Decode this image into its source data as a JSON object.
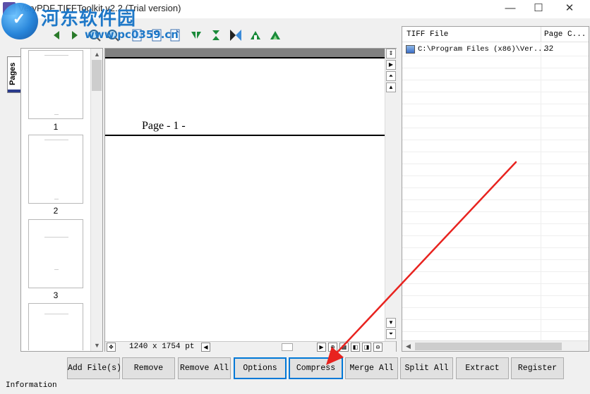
{
  "window": {
    "title": "VeryPDF TIFFToolkit v2.2 (Trial version)",
    "minimize_glyph": "—",
    "maximize_glyph": "☐",
    "close_glyph": "✕"
  },
  "watermark": {
    "site_name": "河东软件园",
    "site_url": "www.pc0359.cn",
    "logo_glyph": "✓"
  },
  "toolbar": {
    "icons": [
      "back-icon",
      "forward-icon",
      "zoom-in-icon",
      "zoom-out-icon",
      "fit-page-icon",
      "fit-width-icon",
      "actual-size-icon",
      "flip-horizontal-icon",
      "flip-vertical-icon",
      "rotate-icon",
      "rotate-left-icon",
      "rotate-right-icon"
    ]
  },
  "sidebar": {
    "tab_label": "Pages",
    "thumbnails": [
      {
        "number": "1"
      },
      {
        "number": "2"
      },
      {
        "number": "3"
      },
      {
        "number": ""
      }
    ]
  },
  "document": {
    "header_text": "Page - 1 -",
    "dimensions": "1240 x 1754 pt"
  },
  "file_list": {
    "columns": [
      "TIFF File",
      "Page C..."
    ],
    "rows": [
      {
        "file": "C:\\Program Files (x86)\\Ver...",
        "pages": "32"
      }
    ]
  },
  "actions": {
    "add_files": "Add File(s)",
    "remove": "Remove",
    "remove_all": "Remove All",
    "options": "Options",
    "compress": "Compress",
    "merge_all": "Merge All",
    "split_all": "Split All",
    "extract": "Extract",
    "register": "Register"
  },
  "status": {
    "info_label": "Information"
  },
  "colors": {
    "annotation_arrow": "#e8231f",
    "focus_border": "#0078d7",
    "watermark_blue": "#1e78c8"
  }
}
